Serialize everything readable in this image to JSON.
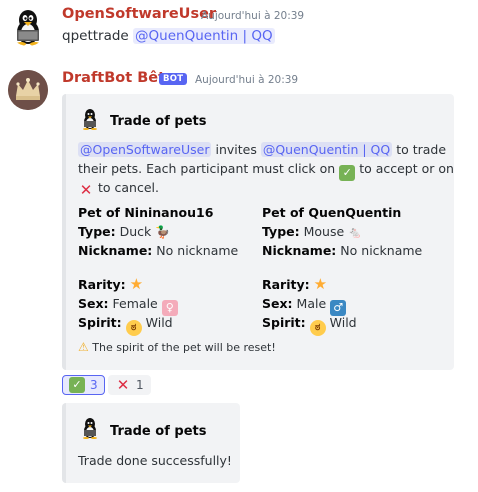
{
  "message1": {
    "username": "OpenSoftwareUser",
    "timestamp": "Aujourd'hui à 20:39",
    "text": "qpettrade",
    "mention": "@QuenQuentin | QQ"
  },
  "message2": {
    "username": "DraftBot Bêta",
    "bot_tag": "BOT",
    "timestamp": "Aujourd'hui à 20:39",
    "embed": {
      "title": "Trade of pets",
      "desc_mention1": "@OpenSoftwareUser",
      "desc_invites": "invites",
      "desc_mention2": "@QuenQuentin | QQ",
      "desc_line1_end": "to trade",
      "desc_line2a": "their pets. Each participant must click on",
      "desc_line2b": "to accept or on",
      "desc_line3": "to cancel.",
      "left": {
        "header": "Pet of Nininanou16",
        "type_label": "Type:",
        "type_value": "Duck",
        "nickname_label": "Nickname:",
        "nickname_value": "No nickname",
        "rarity_label": "Rarity:",
        "sex_label": "Sex:",
        "sex_value": "Female",
        "spirit_label": "Spirit:",
        "spirit_value": "Wild"
      },
      "right": {
        "header": "Pet of QuenQuentin",
        "type_label": "Type:",
        "type_value": "Mouse",
        "nickname_label": "Nickname:",
        "nickname_value": "No nickname",
        "rarity_label": "Rarity:",
        "sex_label": "Sex:",
        "sex_value": "Male",
        "spirit_label": "Spirit:",
        "spirit_value": "Wild"
      },
      "warning": "The spirit of the pet will be reset!"
    },
    "reactions": [
      {
        "emoji": "white-check-mark",
        "count": "3"
      },
      {
        "emoji": "cross-mark",
        "count": "1"
      }
    ],
    "embed2": {
      "title": "Trade of pets",
      "text": "Trade done successfully!"
    }
  },
  "colors": {
    "username1": "#c0392b",
    "username2": "#c0392b",
    "mention": "#5865f2",
    "bot_tag": "#5865f2"
  }
}
